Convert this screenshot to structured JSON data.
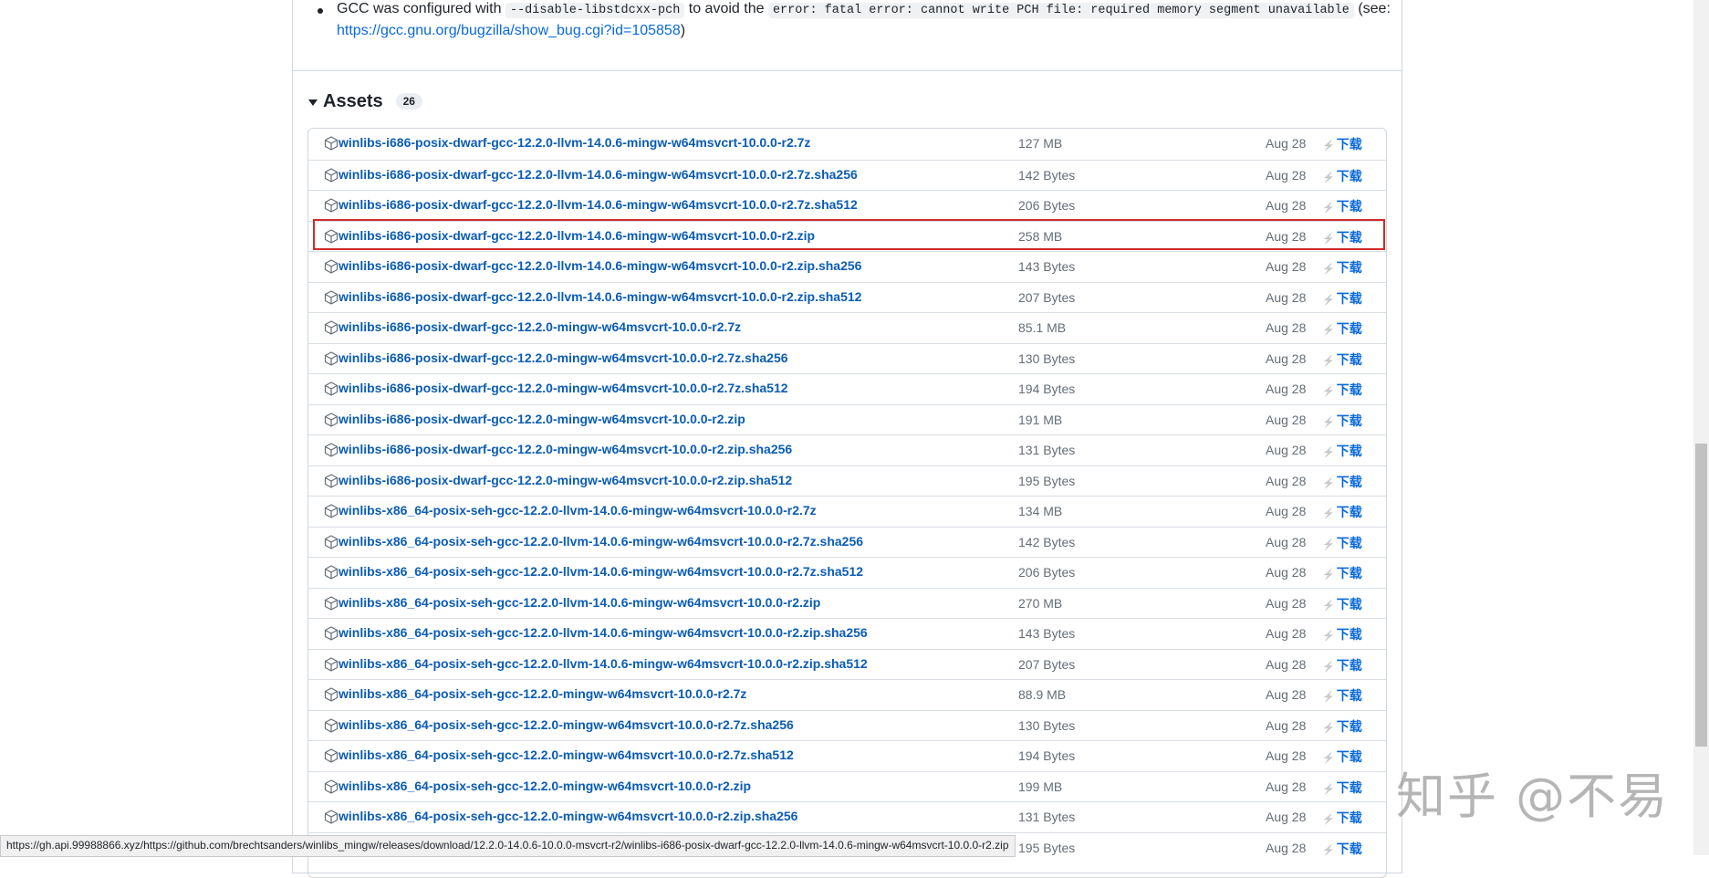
{
  "note": {
    "gcc_prefix": "GCC was configured with",
    "flag_code": "--disable-libstdcxx-pch",
    "middle_text": "to avoid the",
    "error_code": "error: fatal error: cannot write PCH file: required memory segment unavailable",
    "see_open": "(see:",
    "link": "https://gcc.gnu.org/bugzilla/show_bug.cgi?id=105858",
    "close": ")"
  },
  "assets": {
    "title": "Assets",
    "count": "26",
    "download_label": "下载",
    "rows": [
      {
        "name": "winlibs-i686-posix-dwarf-gcc-12.2.0-llvm-14.0.6-mingw-w64msvcrt-10.0.0-r2.7z",
        "size": "127 MB",
        "date": "Aug 28"
      },
      {
        "name": "winlibs-i686-posix-dwarf-gcc-12.2.0-llvm-14.0.6-mingw-w64msvcrt-10.0.0-r2.7z.sha256",
        "size": "142 Bytes",
        "date": "Aug 28"
      },
      {
        "name": "winlibs-i686-posix-dwarf-gcc-12.2.0-llvm-14.0.6-mingw-w64msvcrt-10.0.0-r2.7z.sha512",
        "size": "206 Bytes",
        "date": "Aug 28"
      },
      {
        "name": "winlibs-i686-posix-dwarf-gcc-12.2.0-llvm-14.0.6-mingw-w64msvcrt-10.0.0-r2.zip",
        "size": "258 MB",
        "date": "Aug 28"
      },
      {
        "name": "winlibs-i686-posix-dwarf-gcc-12.2.0-llvm-14.0.6-mingw-w64msvcrt-10.0.0-r2.zip.sha256",
        "size": "143 Bytes",
        "date": "Aug 28"
      },
      {
        "name": "winlibs-i686-posix-dwarf-gcc-12.2.0-llvm-14.0.6-mingw-w64msvcrt-10.0.0-r2.zip.sha512",
        "size": "207 Bytes",
        "date": "Aug 28"
      },
      {
        "name": "winlibs-i686-posix-dwarf-gcc-12.2.0-mingw-w64msvcrt-10.0.0-r2.7z",
        "size": "85.1 MB",
        "date": "Aug 28"
      },
      {
        "name": "winlibs-i686-posix-dwarf-gcc-12.2.0-mingw-w64msvcrt-10.0.0-r2.7z.sha256",
        "size": "130 Bytes",
        "date": "Aug 28"
      },
      {
        "name": "winlibs-i686-posix-dwarf-gcc-12.2.0-mingw-w64msvcrt-10.0.0-r2.7z.sha512",
        "size": "194 Bytes",
        "date": "Aug 28"
      },
      {
        "name": "winlibs-i686-posix-dwarf-gcc-12.2.0-mingw-w64msvcrt-10.0.0-r2.zip",
        "size": "191 MB",
        "date": "Aug 28"
      },
      {
        "name": "winlibs-i686-posix-dwarf-gcc-12.2.0-mingw-w64msvcrt-10.0.0-r2.zip.sha256",
        "size": "131 Bytes",
        "date": "Aug 28"
      },
      {
        "name": "winlibs-i686-posix-dwarf-gcc-12.2.0-mingw-w64msvcrt-10.0.0-r2.zip.sha512",
        "size": "195 Bytes",
        "date": "Aug 28"
      },
      {
        "name": "winlibs-x86_64-posix-seh-gcc-12.2.0-llvm-14.0.6-mingw-w64msvcrt-10.0.0-r2.7z",
        "size": "134 MB",
        "date": "Aug 28"
      },
      {
        "name": "winlibs-x86_64-posix-seh-gcc-12.2.0-llvm-14.0.6-mingw-w64msvcrt-10.0.0-r2.7z.sha256",
        "size": "142 Bytes",
        "date": "Aug 28"
      },
      {
        "name": "winlibs-x86_64-posix-seh-gcc-12.2.0-llvm-14.0.6-mingw-w64msvcrt-10.0.0-r2.7z.sha512",
        "size": "206 Bytes",
        "date": "Aug 28"
      },
      {
        "name": "winlibs-x86_64-posix-seh-gcc-12.2.0-llvm-14.0.6-mingw-w64msvcrt-10.0.0-r2.zip",
        "size": "270 MB",
        "date": "Aug 28"
      },
      {
        "name": "winlibs-x86_64-posix-seh-gcc-12.2.0-llvm-14.0.6-mingw-w64msvcrt-10.0.0-r2.zip.sha256",
        "size": "143 Bytes",
        "date": "Aug 28"
      },
      {
        "name": "winlibs-x86_64-posix-seh-gcc-12.2.0-llvm-14.0.6-mingw-w64msvcrt-10.0.0-r2.zip.sha512",
        "size": "207 Bytes",
        "date": "Aug 28"
      },
      {
        "name": "winlibs-x86_64-posix-seh-gcc-12.2.0-mingw-w64msvcrt-10.0.0-r2.7z",
        "size": "88.9 MB",
        "date": "Aug 28"
      },
      {
        "name": "winlibs-x86_64-posix-seh-gcc-12.2.0-mingw-w64msvcrt-10.0.0-r2.7z.sha256",
        "size": "130 Bytes",
        "date": "Aug 28"
      },
      {
        "name": "winlibs-x86_64-posix-seh-gcc-12.2.0-mingw-w64msvcrt-10.0.0-r2.7z.sha512",
        "size": "194 Bytes",
        "date": "Aug 28"
      },
      {
        "name": "winlibs-x86_64-posix-seh-gcc-12.2.0-mingw-w64msvcrt-10.0.0-r2.zip",
        "size": "199 MB",
        "date": "Aug 28"
      },
      {
        "name": "winlibs-x86_64-posix-seh-gcc-12.2.0-mingw-w64msvcrt-10.0.0-r2.zip.sha256",
        "size": "131 Bytes",
        "date": "Aug 28"
      },
      {
        "name": "",
        "size": "195 Bytes",
        "date": "Aug 28"
      }
    ]
  },
  "status_bar": {
    "url": "https://gh.api.99988866.xyz/https://github.com/brechtsanders/winlibs_mingw/releases/download/12.2.0-14.0.6-10.0.0-msvcrt-r2/winlibs-i686-posix-dwarf-gcc-12.2.0-llvm-14.0.6-mingw-w64msvcrt-10.0.0-r2.zip"
  },
  "watermark": {
    "text": "知乎 @不易"
  },
  "colors": {
    "link": "#0a5cb5",
    "highlight": "#d22a2a",
    "muted": "#656d76"
  },
  "icons": {
    "package": "package-icon",
    "download": "lightning-icon",
    "caret": "caret-down-icon"
  }
}
